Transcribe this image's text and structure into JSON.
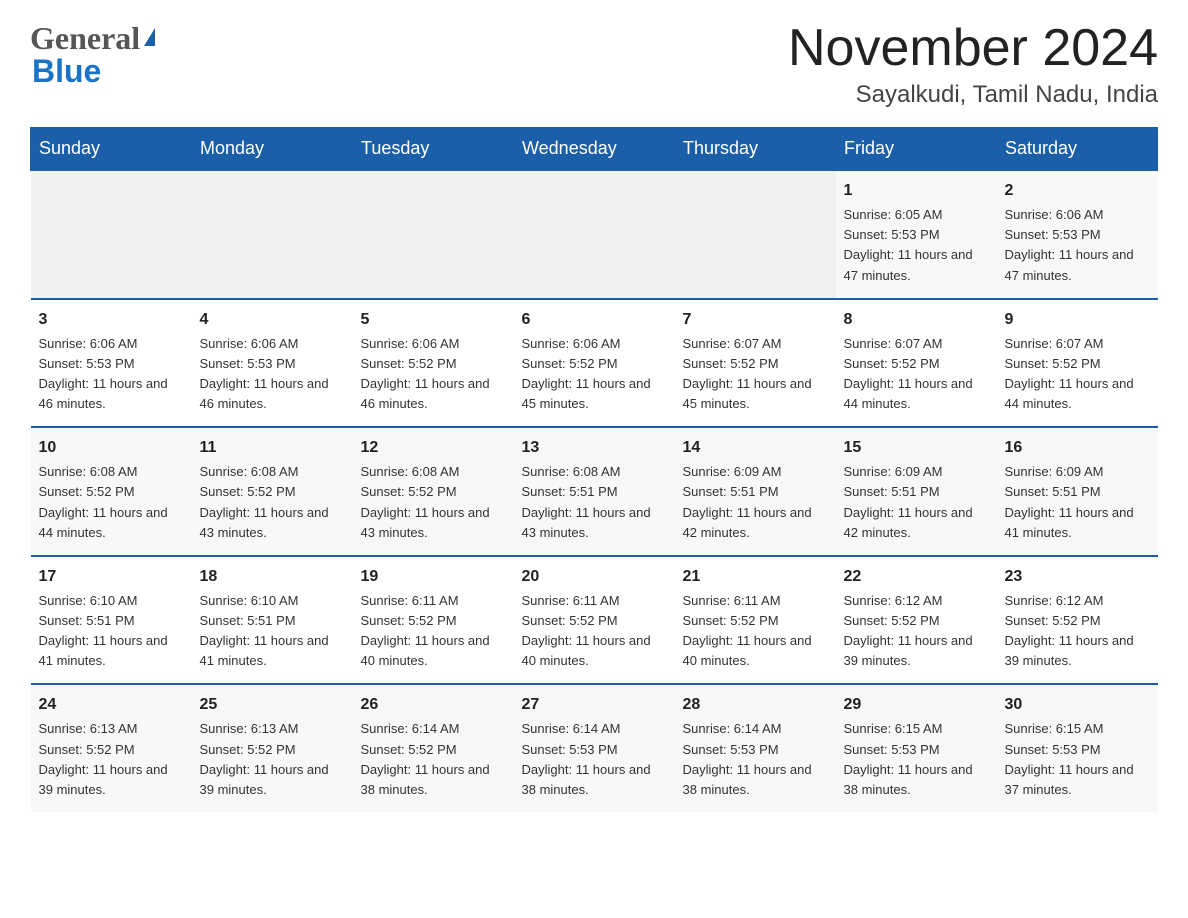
{
  "header": {
    "logo_general": "General",
    "logo_blue": "Blue",
    "month_title": "November 2024",
    "location": "Sayalkudi, Tamil Nadu, India"
  },
  "calendar": {
    "days_of_week": [
      "Sunday",
      "Monday",
      "Tuesday",
      "Wednesday",
      "Thursday",
      "Friday",
      "Saturday"
    ],
    "weeks": [
      [
        {
          "day": "",
          "info": ""
        },
        {
          "day": "",
          "info": ""
        },
        {
          "day": "",
          "info": ""
        },
        {
          "day": "",
          "info": ""
        },
        {
          "day": "",
          "info": ""
        },
        {
          "day": "1",
          "info": "Sunrise: 6:05 AM\nSunset: 5:53 PM\nDaylight: 11 hours and 47 minutes."
        },
        {
          "day": "2",
          "info": "Sunrise: 6:06 AM\nSunset: 5:53 PM\nDaylight: 11 hours and 47 minutes."
        }
      ],
      [
        {
          "day": "3",
          "info": "Sunrise: 6:06 AM\nSunset: 5:53 PM\nDaylight: 11 hours and 46 minutes."
        },
        {
          "day": "4",
          "info": "Sunrise: 6:06 AM\nSunset: 5:53 PM\nDaylight: 11 hours and 46 minutes."
        },
        {
          "day": "5",
          "info": "Sunrise: 6:06 AM\nSunset: 5:52 PM\nDaylight: 11 hours and 46 minutes."
        },
        {
          "day": "6",
          "info": "Sunrise: 6:06 AM\nSunset: 5:52 PM\nDaylight: 11 hours and 45 minutes."
        },
        {
          "day": "7",
          "info": "Sunrise: 6:07 AM\nSunset: 5:52 PM\nDaylight: 11 hours and 45 minutes."
        },
        {
          "day": "8",
          "info": "Sunrise: 6:07 AM\nSunset: 5:52 PM\nDaylight: 11 hours and 44 minutes."
        },
        {
          "day": "9",
          "info": "Sunrise: 6:07 AM\nSunset: 5:52 PM\nDaylight: 11 hours and 44 minutes."
        }
      ],
      [
        {
          "day": "10",
          "info": "Sunrise: 6:08 AM\nSunset: 5:52 PM\nDaylight: 11 hours and 44 minutes."
        },
        {
          "day": "11",
          "info": "Sunrise: 6:08 AM\nSunset: 5:52 PM\nDaylight: 11 hours and 43 minutes."
        },
        {
          "day": "12",
          "info": "Sunrise: 6:08 AM\nSunset: 5:52 PM\nDaylight: 11 hours and 43 minutes."
        },
        {
          "day": "13",
          "info": "Sunrise: 6:08 AM\nSunset: 5:51 PM\nDaylight: 11 hours and 43 minutes."
        },
        {
          "day": "14",
          "info": "Sunrise: 6:09 AM\nSunset: 5:51 PM\nDaylight: 11 hours and 42 minutes."
        },
        {
          "day": "15",
          "info": "Sunrise: 6:09 AM\nSunset: 5:51 PM\nDaylight: 11 hours and 42 minutes."
        },
        {
          "day": "16",
          "info": "Sunrise: 6:09 AM\nSunset: 5:51 PM\nDaylight: 11 hours and 41 minutes."
        }
      ],
      [
        {
          "day": "17",
          "info": "Sunrise: 6:10 AM\nSunset: 5:51 PM\nDaylight: 11 hours and 41 minutes."
        },
        {
          "day": "18",
          "info": "Sunrise: 6:10 AM\nSunset: 5:51 PM\nDaylight: 11 hours and 41 minutes."
        },
        {
          "day": "19",
          "info": "Sunrise: 6:11 AM\nSunset: 5:52 PM\nDaylight: 11 hours and 40 minutes."
        },
        {
          "day": "20",
          "info": "Sunrise: 6:11 AM\nSunset: 5:52 PM\nDaylight: 11 hours and 40 minutes."
        },
        {
          "day": "21",
          "info": "Sunrise: 6:11 AM\nSunset: 5:52 PM\nDaylight: 11 hours and 40 minutes."
        },
        {
          "day": "22",
          "info": "Sunrise: 6:12 AM\nSunset: 5:52 PM\nDaylight: 11 hours and 39 minutes."
        },
        {
          "day": "23",
          "info": "Sunrise: 6:12 AM\nSunset: 5:52 PM\nDaylight: 11 hours and 39 minutes."
        }
      ],
      [
        {
          "day": "24",
          "info": "Sunrise: 6:13 AM\nSunset: 5:52 PM\nDaylight: 11 hours and 39 minutes."
        },
        {
          "day": "25",
          "info": "Sunrise: 6:13 AM\nSunset: 5:52 PM\nDaylight: 11 hours and 39 minutes."
        },
        {
          "day": "26",
          "info": "Sunrise: 6:14 AM\nSunset: 5:52 PM\nDaylight: 11 hours and 38 minutes."
        },
        {
          "day": "27",
          "info": "Sunrise: 6:14 AM\nSunset: 5:53 PM\nDaylight: 11 hours and 38 minutes."
        },
        {
          "day": "28",
          "info": "Sunrise: 6:14 AM\nSunset: 5:53 PM\nDaylight: 11 hours and 38 minutes."
        },
        {
          "day": "29",
          "info": "Sunrise: 6:15 AM\nSunset: 5:53 PM\nDaylight: 11 hours and 38 minutes."
        },
        {
          "day": "30",
          "info": "Sunrise: 6:15 AM\nSunset: 5:53 PM\nDaylight: 11 hours and 37 minutes."
        }
      ]
    ]
  }
}
